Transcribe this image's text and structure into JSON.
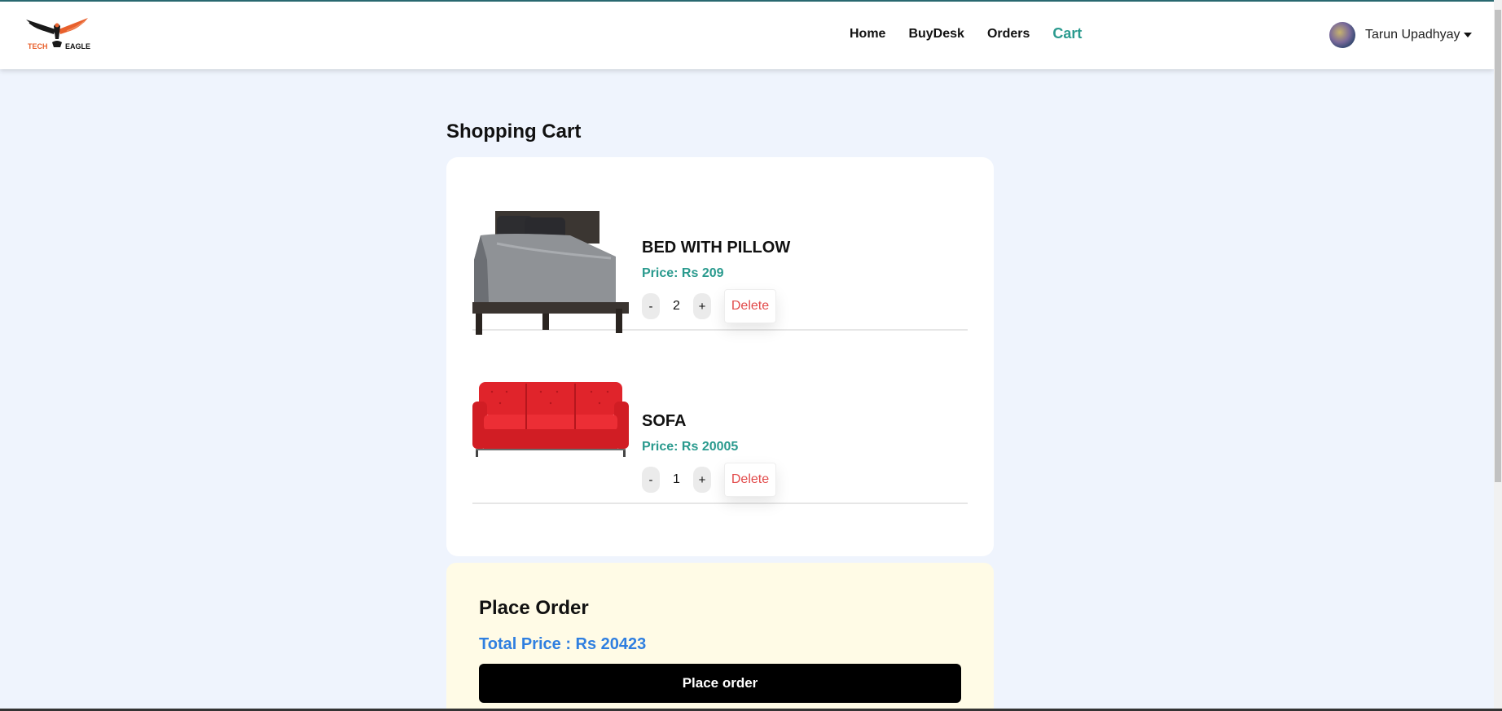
{
  "brand": {
    "logo_word_1": "TECH",
    "logo_word_2": "EAGLE",
    "accent": "#e8602c"
  },
  "nav": {
    "links": [
      {
        "label": "Home"
      },
      {
        "label": "BuyDesk"
      },
      {
        "label": "Orders"
      },
      {
        "label": "Cart",
        "active": true
      }
    ],
    "active_color": "#2a9a8e"
  },
  "user": {
    "name": "Tarun Upadhyay",
    "avatar_icon": "user-avatar",
    "menu_icon": "caret-down-icon"
  },
  "page": {
    "title": "Shopping Cart"
  },
  "cart": {
    "items": [
      {
        "name": "BED WITH PILLOW",
        "price": "Price: Rs 209",
        "quantity": "2",
        "decrement": "-",
        "increment": "+",
        "delete": "Delete",
        "image_icon": "bed-image"
      },
      {
        "name": "SOFA",
        "price": "Price: Rs 20005",
        "quantity": "1",
        "decrement": "-",
        "increment": "+",
        "delete": "Delete",
        "image_icon": "sofa-image"
      }
    ]
  },
  "order": {
    "title": "Place Order",
    "total": "Total Price : Rs 20423",
    "button": "Place order",
    "background": "#fffbe6",
    "total_color": "#2f7fe0"
  }
}
